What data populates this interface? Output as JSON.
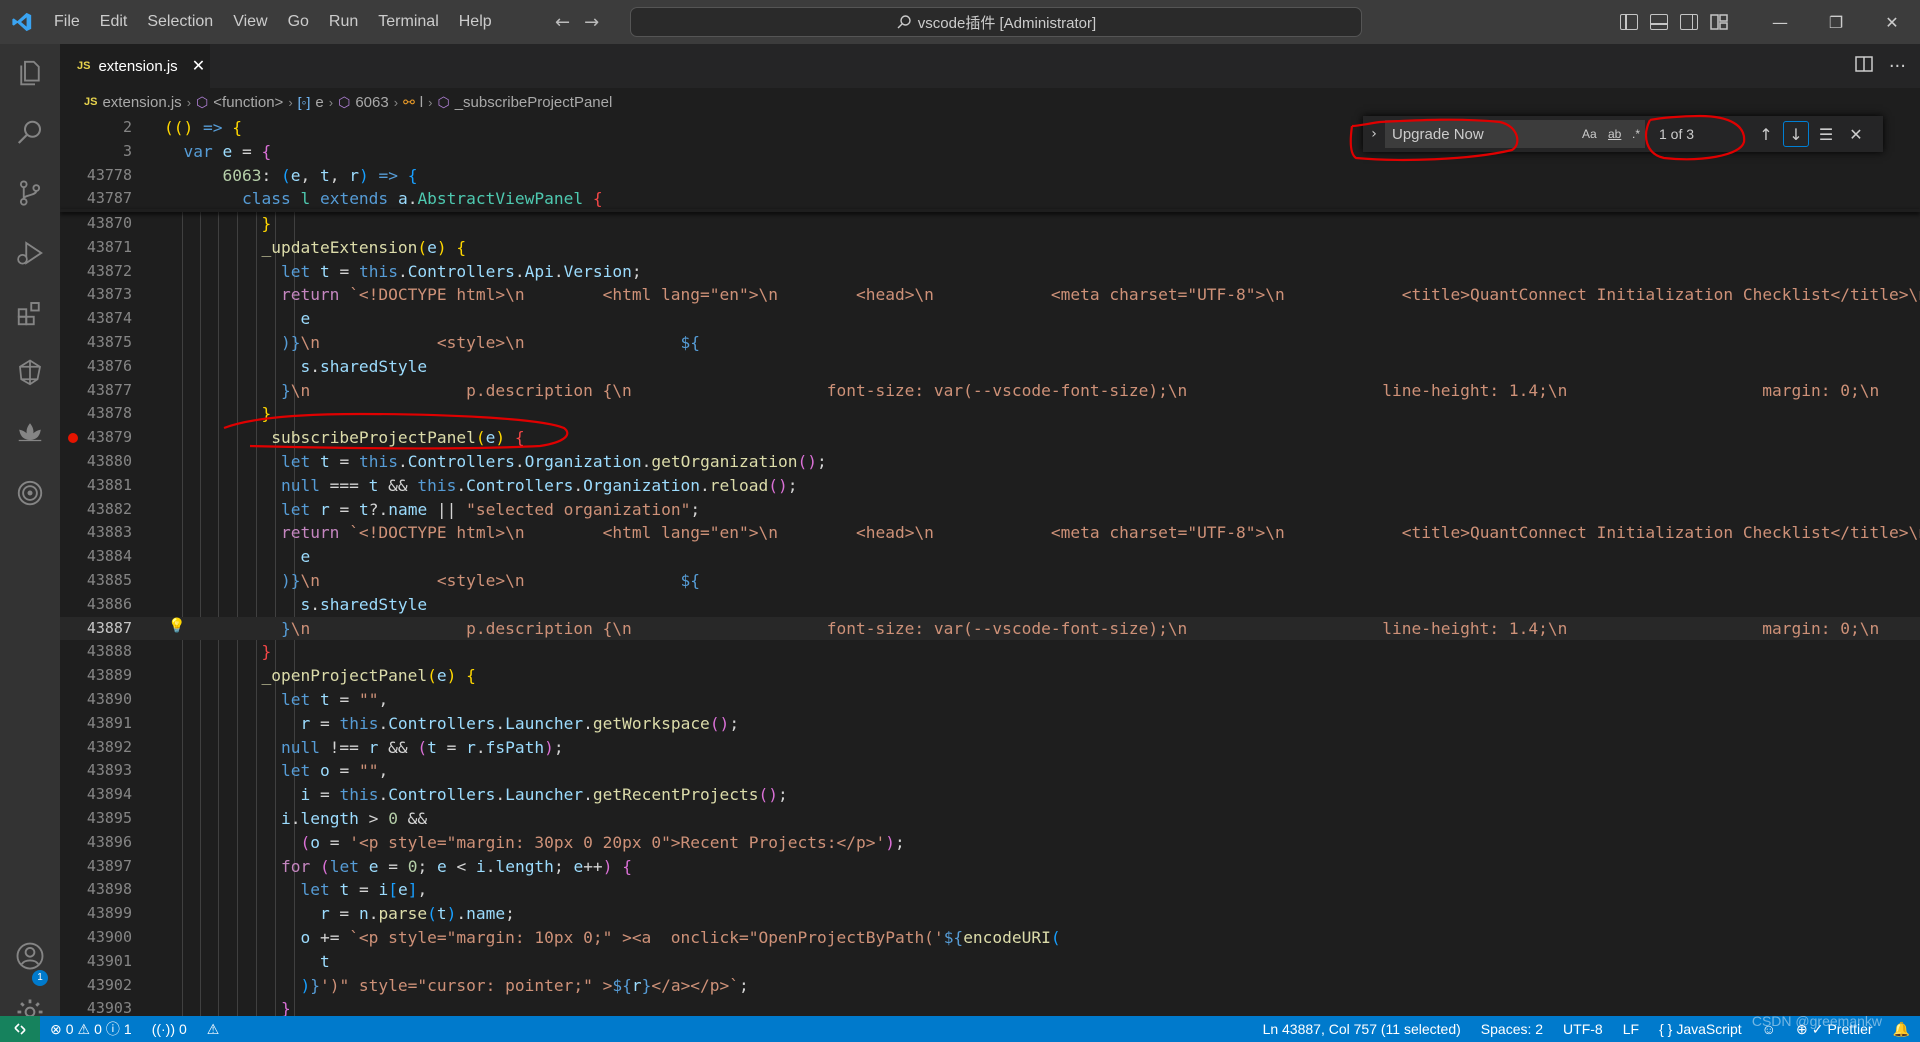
{
  "titlebar": {
    "menu": [
      "File",
      "Edit",
      "Selection",
      "View",
      "Go",
      "Run",
      "Terminal",
      "Help"
    ],
    "command_center": "vscode插件 [Administrator]",
    "window_controls": [
      "minimize",
      "restore",
      "close"
    ]
  },
  "activitybar": {
    "icons": [
      "files-icon",
      "search-icon",
      "source-control-icon",
      "run-debug-icon",
      "extensions-icon",
      "quantconnect-icon",
      "lotus-icon",
      "spiral-icon",
      "accounts-icon",
      "settings-icon"
    ],
    "accounts_badge": "1"
  },
  "tab": {
    "badge": "JS",
    "label": "extension.js"
  },
  "breadcrumbs": [
    {
      "icon": "JS",
      "label": "extension.js"
    },
    {
      "icon": "cube",
      "label": "<function>"
    },
    {
      "icon": "var",
      "label": "e"
    },
    {
      "icon": "cube",
      "label": "6063"
    },
    {
      "icon": "class",
      "label": "l"
    },
    {
      "icon": "cube",
      "label": "_subscribeProjectPanel"
    }
  ],
  "find": {
    "query": "Upgrade Now",
    "match_case": "Aa",
    "whole_word": "ab",
    "regex": ".*",
    "match_count": "1 of 3"
  },
  "editor": {
    "line_numbers": [
      "2",
      "3",
      "43778",
      "43787",
      "43870",
      "43871",
      "43872",
      "43873",
      "43874",
      "43875",
      "43876",
      "43877",
      "43878",
      "43879",
      "43880",
      "43881",
      "43882",
      "43883",
      "43884",
      "43885",
      "43886",
      "43887",
      "43888",
      "43889",
      "43890",
      "43891",
      "43892",
      "43893",
      "43894",
      "43895",
      "43896",
      "43897",
      "43898",
      "43899",
      "43900",
      "43901",
      "43902",
      "43903"
    ],
    "active_line": "43887",
    "breakpoint_line": "43879"
  },
  "statusbar": {
    "errors": "0",
    "warnings": "0",
    "info": "1",
    "ports": "0",
    "position": "Ln 43887, Col 757 (11 selected)",
    "spaces": "Spaces: 2",
    "encoding": "UTF-8",
    "eol": "LF",
    "language": "JavaScript",
    "prettier": "Prettier",
    "watermark": "CSDN @greemankw"
  }
}
